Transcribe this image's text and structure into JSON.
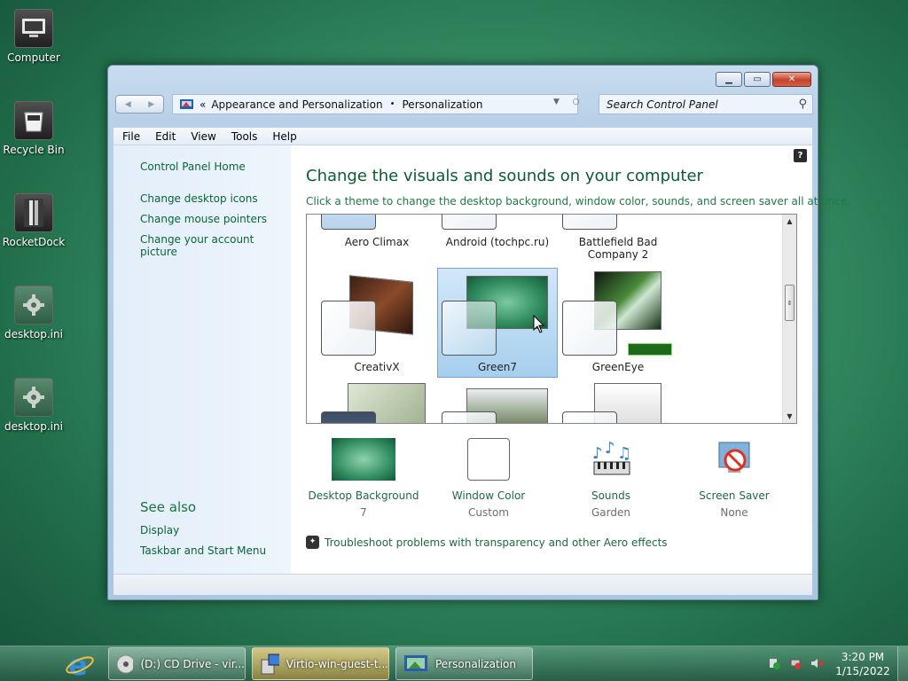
{
  "desktop": {
    "icons": [
      {
        "label": "Computer"
      },
      {
        "label": "Recycle Bin"
      },
      {
        "label": "RocketDock"
      },
      {
        "label": "desktop.ini"
      },
      {
        "label": "desktop.ini"
      }
    ]
  },
  "window": {
    "breadcrumb": {
      "prefix": "«",
      "parent": "Appearance and Personalization",
      "separator": "•",
      "current": "Personalization"
    },
    "search_placeholder": "Search Control Panel",
    "menu": [
      "File",
      "Edit",
      "View",
      "Tools",
      "Help"
    ],
    "left_pane": {
      "home": "Control Panel Home",
      "links": [
        "Change desktop icons",
        "Change mouse pointers",
        "Change your account picture"
      ],
      "see_also_title": "See also",
      "see_also": [
        "Display",
        "Taskbar and Start Menu"
      ]
    },
    "help_label": "?",
    "title": "Change the visuals and sounds on your computer",
    "subtitle": "Click a theme to change the desktop background, window color, sounds, and screen saver all at once.",
    "themes": [
      {
        "name": "Aero Climax"
      },
      {
        "name": "Android (tochpc.ru)"
      },
      {
        "name": "Battlefield Bad Company 2"
      },
      {
        "name": "CreativX"
      },
      {
        "name": "Green7",
        "selected": true
      },
      {
        "name": "GreenEye"
      }
    ],
    "settings": [
      {
        "label": "Desktop Background",
        "value": "7",
        "icon": "desktop-background-icon"
      },
      {
        "label": "Window Color",
        "value": "Custom",
        "icon": "window-color-icon"
      },
      {
        "label": "Sounds",
        "value": "Garden",
        "icon": "sounds-icon"
      },
      {
        "label": "Screen Saver",
        "value": "None",
        "icon": "screen-saver-icon"
      }
    ],
    "troubleshoot": "Troubleshoot problems with transparency and other Aero effects"
  },
  "taskbar": {
    "tasks": [
      {
        "label": "(D:) CD Drive - vir..."
      },
      {
        "label": "Virtio-win-guest-t..."
      },
      {
        "label": "Personalization"
      }
    ],
    "clock": {
      "time": "3:20 PM",
      "date": "1/15/2022"
    }
  },
  "colors": {
    "link": "#0a6536",
    "heading": "#0b5c33",
    "selection": "#a6cfee"
  }
}
